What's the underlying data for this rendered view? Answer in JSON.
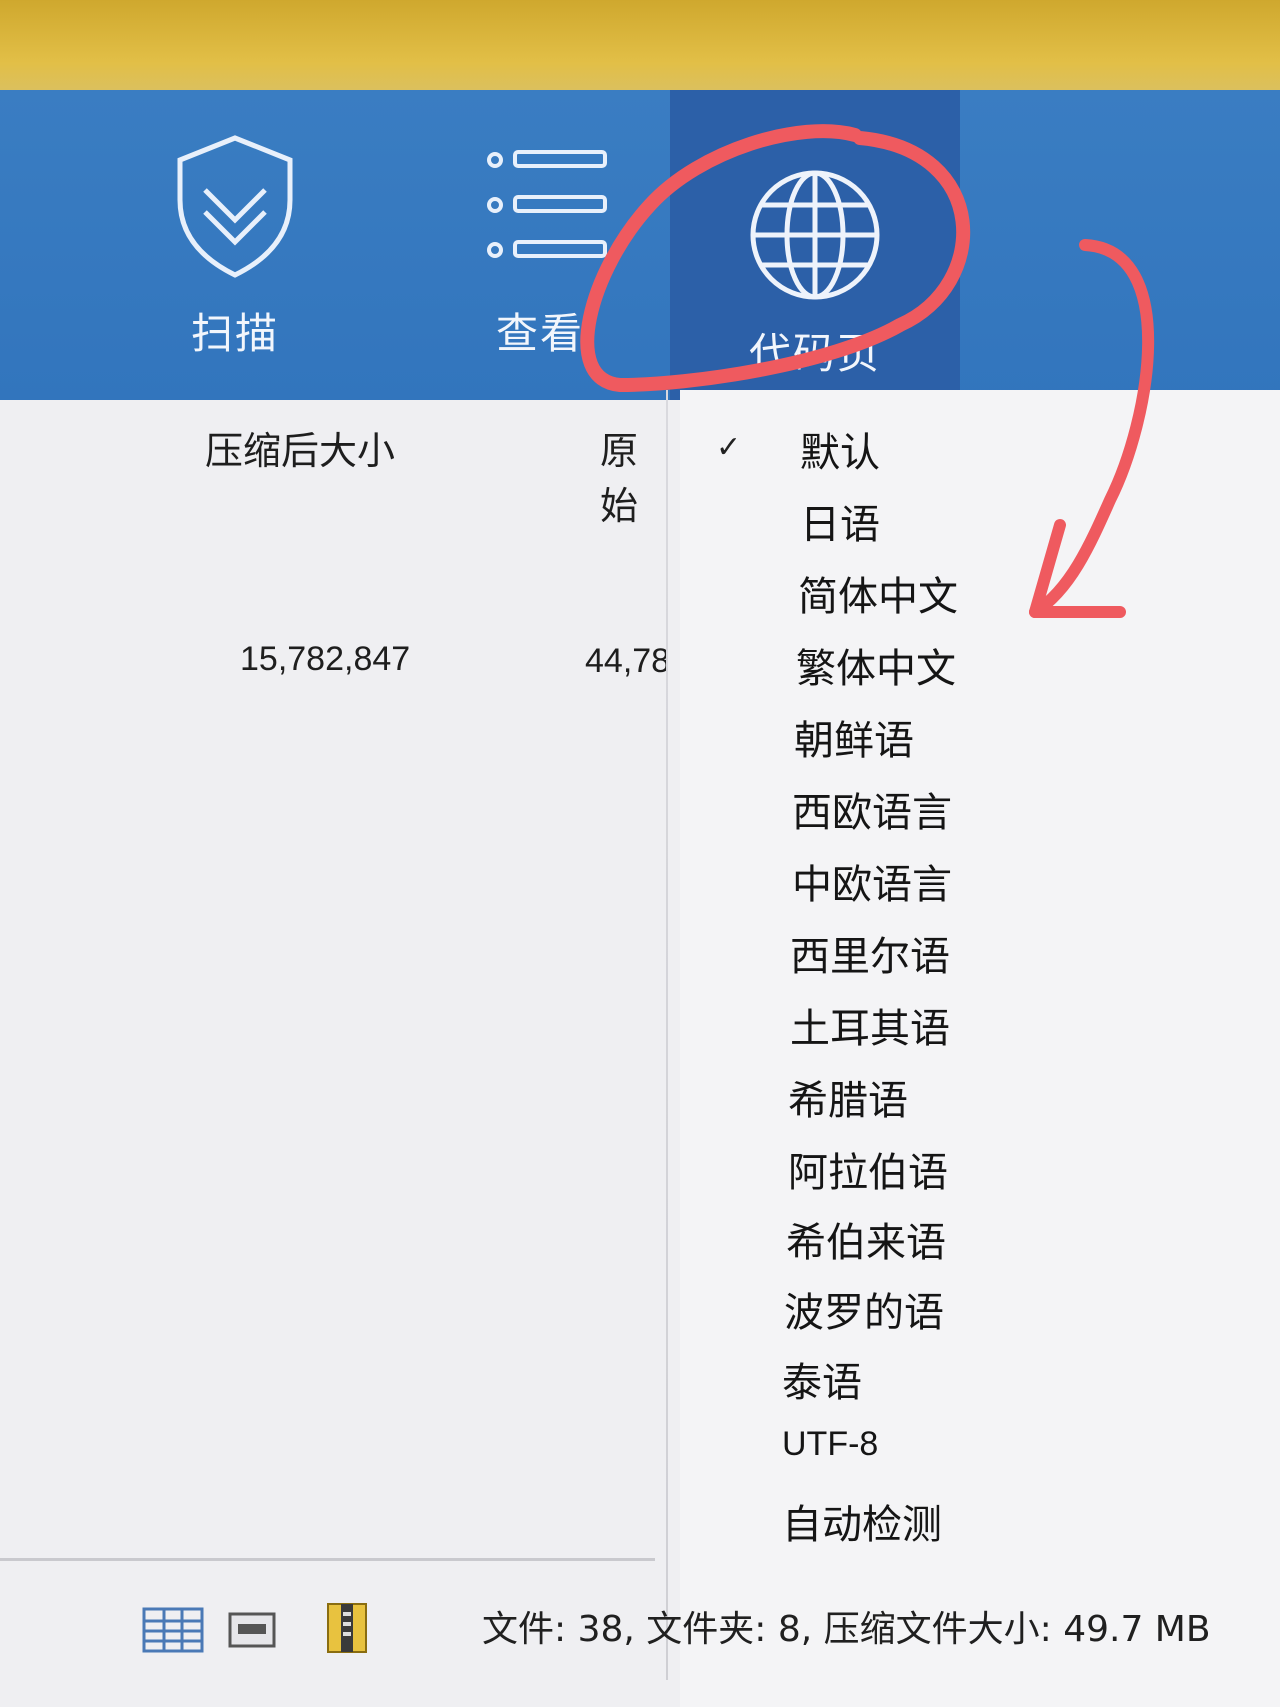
{
  "ribbon": {
    "buttons": [
      {
        "label": "扫描",
        "icon": "shield-check-icon"
      },
      {
        "label": "查看",
        "icon": "list-view-icon"
      },
      {
        "label": "代码页",
        "icon": "globe-icon",
        "active": true
      }
    ],
    "color": "#3476be",
    "active_color": "#2c60a8"
  },
  "table": {
    "columns": [
      "压缩后大小",
      "原始"
    ],
    "rows": [
      {
        "compressed_size": "15,782,847",
        "original_size": "44,78"
      }
    ]
  },
  "codepage_menu": {
    "check_mark": "✓",
    "items": [
      {
        "label": "默认",
        "checked": true
      },
      {
        "label": "日语"
      },
      {
        "label": "简体中文"
      },
      {
        "label": "繁体中文"
      },
      {
        "label": "朝鲜语"
      },
      {
        "label": "西欧语言"
      },
      {
        "label": "中欧语言"
      },
      {
        "label": "西里尔语"
      },
      {
        "label": "土耳其语"
      },
      {
        "label": "希腊语"
      },
      {
        "label": "阿拉伯语"
      },
      {
        "label": "希伯来语"
      },
      {
        "label": "波罗的语"
      },
      {
        "label": "泰语"
      },
      {
        "label": "UTF-8"
      },
      {
        "label": "自动检测"
      }
    ]
  },
  "status_bar": {
    "text": "文件: 38, 文件夹: 8, 压缩文件大小: 49.7 MB",
    "view_icons": [
      "details-view-icon",
      "window-view-icon",
      "archive-view-icon"
    ]
  },
  "annotation": {
    "color": "#ef5a5f",
    "shapes": [
      "circle-highlight",
      "arrow"
    ]
  }
}
